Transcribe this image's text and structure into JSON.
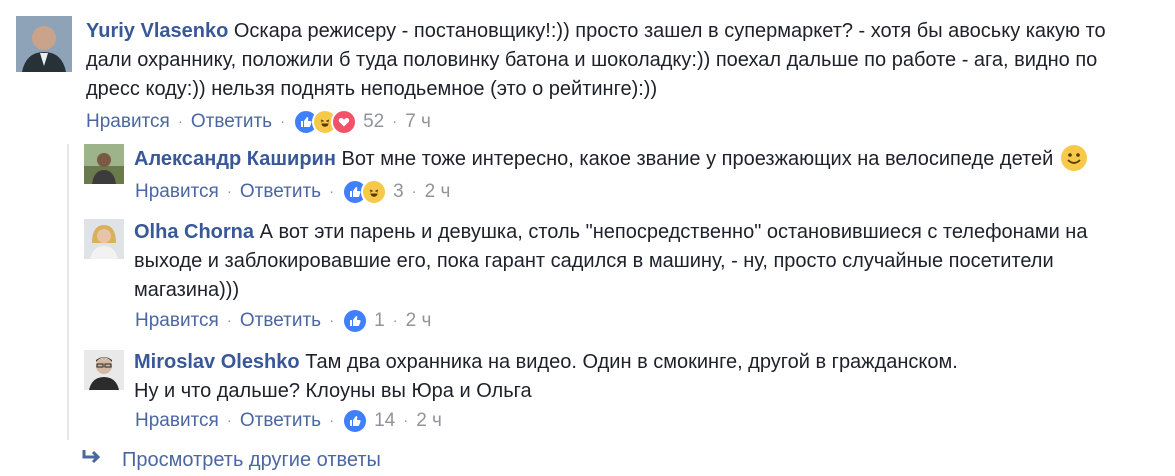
{
  "comments": [
    {
      "author": "Yuriy Vlasenko",
      "text": "Оскара режисеру - постановщику!:)) просто зашел в супермаркет? - хотя бы авоську какую то дали охраннику, положили б туда половинку батона и шоколадку:)) поехал дальше по работе - ага, видно по дресс коду:)) нельзя поднять неподьемное (это о рейтинге):))",
      "like_label": "Нравится",
      "reply_label": "Ответить",
      "reactions": [
        "like-icon",
        "haha-icon",
        "love-icon"
      ],
      "reaction_count": "52",
      "time": "7 ч"
    },
    {
      "author": "Александр Каширин",
      "text": "Вот мне тоже интересно, какое звание у проезжающих на велосипеде детей",
      "like_label": "Нравится",
      "reply_label": "Ответить",
      "reactions": [
        "like-icon",
        "haha-icon"
      ],
      "reaction_count": "3",
      "time": "2 ч"
    },
    {
      "author": "Olha Chorna",
      "text": "А вот эти парень и девушка, столь \"непосредственно\" остановившиеся с телефонами на выходе и заблокировавшие его, пока гарант садился в машину, - ну, просто случайные посетители магазина)))",
      "like_label": "Нравится",
      "reply_label": "Ответить",
      "reactions": [
        "like-icon"
      ],
      "reaction_count": "1",
      "time": "2 ч"
    },
    {
      "author": "Miroslav Oleshko",
      "text_line1": "Там два охранника на видео. Один в смокинге, другой в гражданском.",
      "text_line2": "Ну и что дальше? Клоуны вы Юра и Ольга",
      "like_label": "Нравится",
      "reply_label": "Ответить",
      "reactions": [
        "like-icon"
      ],
      "reaction_count": "14",
      "time": "2 ч"
    }
  ],
  "more_replies": {
    "label": "Просмотреть другие ответы",
    "icon": "reply-arrow-icon"
  },
  "colors": {
    "author": "#385898",
    "link": "#4b67a1",
    "meta": "#90949c",
    "like": "#4080ff",
    "haha": "#f7c94b",
    "love": "#f25268"
  }
}
